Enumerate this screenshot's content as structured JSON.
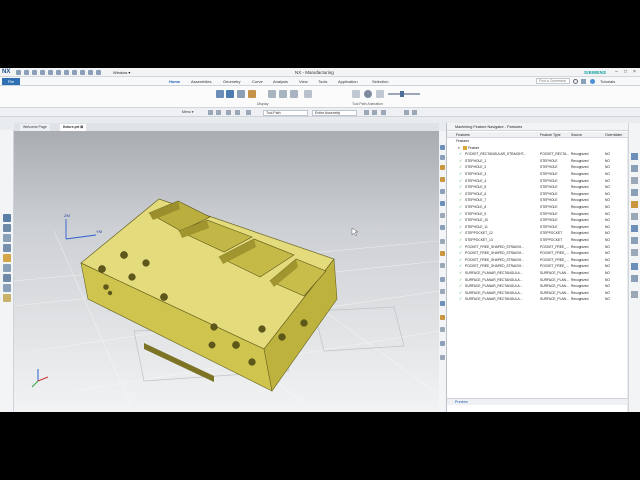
{
  "app": {
    "logo": "NX",
    "title": "NX - Manufacturing",
    "window_menu": "Window ▾",
    "brand": "SIEMENS"
  },
  "ribbon": {
    "file": "File",
    "tabs": [
      "Home",
      "Assemblies",
      "Geometry",
      "Curve",
      "Analysis",
      "View",
      "Tools",
      "Application",
      "Selection"
    ],
    "active_tab": "Home",
    "search_placeholder": "Find a Command",
    "tutorials": "Tutorials",
    "groups": [
      "Display",
      "Tool Path Animation"
    ]
  },
  "selection_bar": {
    "menu": "Menu ▾",
    "filter": "Tool Path",
    "scope": "Entire Assembly"
  },
  "doc_tabs": [
    "Welcome Page",
    "fixture.prt ⊠"
  ],
  "navigator": {
    "title": "Machining Feature Navigator - Features",
    "columns": [
      "Features",
      "Feature Type",
      "Source",
      "Overridden"
    ],
    "root": "Features",
    "group": "Feature",
    "rows": [
      {
        "name": "POCKET_RECTANGULAR_STRAIGHT...",
        "type": "POCKET_RECTA...",
        "source": "Recognized",
        "over": "NO"
      },
      {
        "name": "STEPHOLE_1",
        "type": "STEPHOLE",
        "source": "Recognized",
        "over": "NO"
      },
      {
        "name": "STEPHOLE_2",
        "type": "STEPHOLE",
        "source": "Recognized",
        "over": "NO"
      },
      {
        "name": "STEPHOLE_3",
        "type": "STEPHOLE",
        "source": "Recognized",
        "over": "NO"
      },
      {
        "name": "STEPHOLE_4",
        "type": "STEPHOLE",
        "source": "Recognized",
        "over": "NO"
      },
      {
        "name": "STEPHOLE_5",
        "type": "STEPHOLE",
        "source": "Recognized",
        "over": "NO"
      },
      {
        "name": "STEPHOLE_6",
        "type": "STEPHOLE",
        "source": "Recognized",
        "over": "NO"
      },
      {
        "name": "STEPHOLE_7",
        "type": "STEPHOLE",
        "source": "Recognized",
        "over": "NO"
      },
      {
        "name": "STEPHOLE_8",
        "type": "STEPHOLE",
        "source": "Recognized",
        "over": "NO"
      },
      {
        "name": "STEPHOLE_9",
        "type": "STEPHOLE",
        "source": "Recognized",
        "over": "NO"
      },
      {
        "name": "STEPHOLE_10",
        "type": "STEPHOLE",
        "source": "Recognized",
        "over": "NO"
      },
      {
        "name": "STEPHOLE_11",
        "type": "STEPHOLE",
        "source": "Recognized",
        "over": "NO"
      },
      {
        "name": "STEPPOCKET_12",
        "type": "STEPPOCKET",
        "source": "Recognized",
        "over": "NO"
      },
      {
        "name": "STEPPOCKET_13",
        "type": "STEPPOCKET",
        "source": "Recognized",
        "over": "NO"
      },
      {
        "name": "POCKET_FREE_SHAPED_STRAIGH...",
        "type": "POCKET_FREE_...",
        "source": "Recognized",
        "over": "NO"
      },
      {
        "name": "POCKET_FREE_SHAPED_STRAIGH...",
        "type": "POCKET_FREE_...",
        "source": "Recognized",
        "over": "NO"
      },
      {
        "name": "POCKET_FREE_SHAPED_STRAIGH...",
        "type": "POCKET_FREE_...",
        "source": "Recognized",
        "over": "NO"
      },
      {
        "name": "POCKET_FREE_SHAPED_STRAIGH...",
        "type": "POCKET_FREE_...",
        "source": "Recognized",
        "over": "NO"
      },
      {
        "name": "SURFACE_PLANAR_RECTANGULA...",
        "type": "SURFACE_PLAN...",
        "source": "Recognized",
        "over": "NO"
      },
      {
        "name": "SURFACE_PLANAR_RECTANGULA...",
        "type": "SURFACE_PLAN...",
        "source": "Recognized",
        "over": "NO"
      },
      {
        "name": "SURFACE_PLANAR_RECTANGULA...",
        "type": "SURFACE_PLAN...",
        "source": "Recognized",
        "over": "NO"
      },
      {
        "name": "SURFACE_PLANAR_RECTANGULA...",
        "type": "SURFACE_PLAN...",
        "source": "Recognized",
        "over": "NO"
      },
      {
        "name": "SURFACE_PLANAR_RECTANGULA...",
        "type": "SURFACE_PLAN...",
        "source": "Recognized",
        "over": "NO"
      }
    ],
    "preview": "Preview"
  },
  "viewport": {
    "axis_z": "ZM",
    "axis_y": "YM",
    "part_color": "#e4dc7c",
    "check_color": "#1e9e3a"
  }
}
